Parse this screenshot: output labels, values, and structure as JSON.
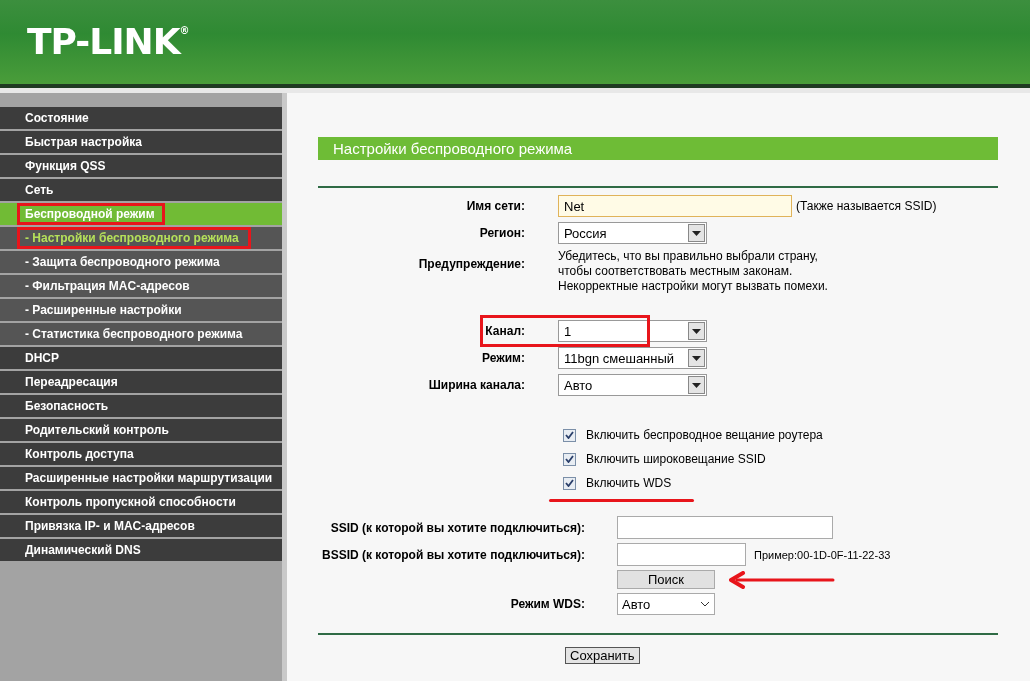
{
  "header": {
    "logo": "TP-LINK$^{®}$"
  },
  "sidebar": {
    "items": [
      {
        "label": "Состояние",
        "kind": "main",
        "selected": false,
        "highlighted": false
      },
      {
        "label": "Быстрая настройка",
        "kind": "main",
        "selected": false,
        "highlighted": false
      },
      {
        "label": "Функция QSS",
        "kind": "main",
        "selected": false,
        "highlighted": false
      },
      {
        "label": "Сеть",
        "kind": "main",
        "selected": false,
        "highlighted": false
      },
      {
        "label": "Беспроводной режим",
        "kind": "main",
        "selected": true,
        "highlighted": true
      },
      {
        "label": "- Настройки беспроводного режима",
        "kind": "sub",
        "selected": true,
        "highlighted": true
      },
      {
        "label": "- Защита беспроводного режима",
        "kind": "sub",
        "selected": false,
        "highlighted": false
      },
      {
        "label": "- Фильтрация MAC-адресов",
        "kind": "sub",
        "selected": false,
        "highlighted": false
      },
      {
        "label": "- Расширенные настройки",
        "kind": "sub",
        "selected": false,
        "highlighted": false
      },
      {
        "label": "- Статистика беспроводного режима",
        "kind": "sub",
        "selected": false,
        "highlighted": false
      },
      {
        "label": "DHCP",
        "kind": "main",
        "selected": false,
        "highlighted": false
      },
      {
        "label": "Переадресация",
        "kind": "main",
        "selected": false,
        "highlighted": false
      },
      {
        "label": "Безопасность",
        "kind": "main",
        "selected": false,
        "highlighted": false
      },
      {
        "label": "Родительский контроль",
        "kind": "main",
        "selected": false,
        "highlighted": false
      },
      {
        "label": "Контроль доступа",
        "kind": "main",
        "selected": false,
        "highlighted": false
      },
      {
        "label": "Расширенные настройки маршрутизации",
        "kind": "main",
        "selected": false,
        "highlighted": false
      },
      {
        "label": "Контроль пропускной способности",
        "kind": "main",
        "selected": false,
        "highlighted": false
      },
      {
        "label": "Привязка IP- и MAC-адресов",
        "kind": "main",
        "selected": false,
        "highlighted": false
      },
      {
        "label": "Динамический DNS",
        "kind": "main",
        "selected": false,
        "highlighted": false
      }
    ]
  },
  "panel": {
    "title": "Настройки беспроводного режима",
    "groups": [
      [
        {
          "kind": "input",
          "label": "Имя сети:",
          "value": "Net",
          "hint": "(Также называется SSID)",
          "highlighted": false
        },
        {
          "kind": "select",
          "label": "Регион:",
          "value": "Россия",
          "highlighted": false
        },
        {
          "kind": "note",
          "label": "Предупреждение:",
          "lines": [
            "Убедитесь, что вы правильно выбрали страну,",
            "чтобы соответствовать местным законам.",
            "Некорректные настройки могут вызвать помехи."
          ],
          "highlighted": false
        }
      ],
      [
        {
          "kind": "select",
          "label": "Канал:",
          "value": "1",
          "highlighted": true
        },
        {
          "kind": "select",
          "label": "Режим:",
          "value": "11bgn смешанный",
          "highlighted": false
        },
        {
          "kind": "select",
          "label": "Ширина канала:",
          "value": "Авто",
          "highlighted": false
        }
      ]
    ],
    "checkboxes": [
      {
        "label": "Включить беспроводное вещание роутера",
        "checked": true,
        "underlined": false
      },
      {
        "label": "Включить широковещание SSID",
        "checked": true,
        "underlined": false
      },
      {
        "label": "Включить WDS",
        "checked": true,
        "underlined": true
      }
    ],
    "wds": {
      "ssid_label": "SSID (к которой вы хотите подключиться):",
      "bssid_label": "BSSID (к которой вы хотите подключиться):",
      "bssid_hint": "Пример:00-1D-0F-11-22-33",
      "search_button": "Поиск",
      "search_arrow": true,
      "mode_label": "Режим WDS:",
      "mode_value": "Авто"
    },
    "save_button": "Сохранить"
  }
}
